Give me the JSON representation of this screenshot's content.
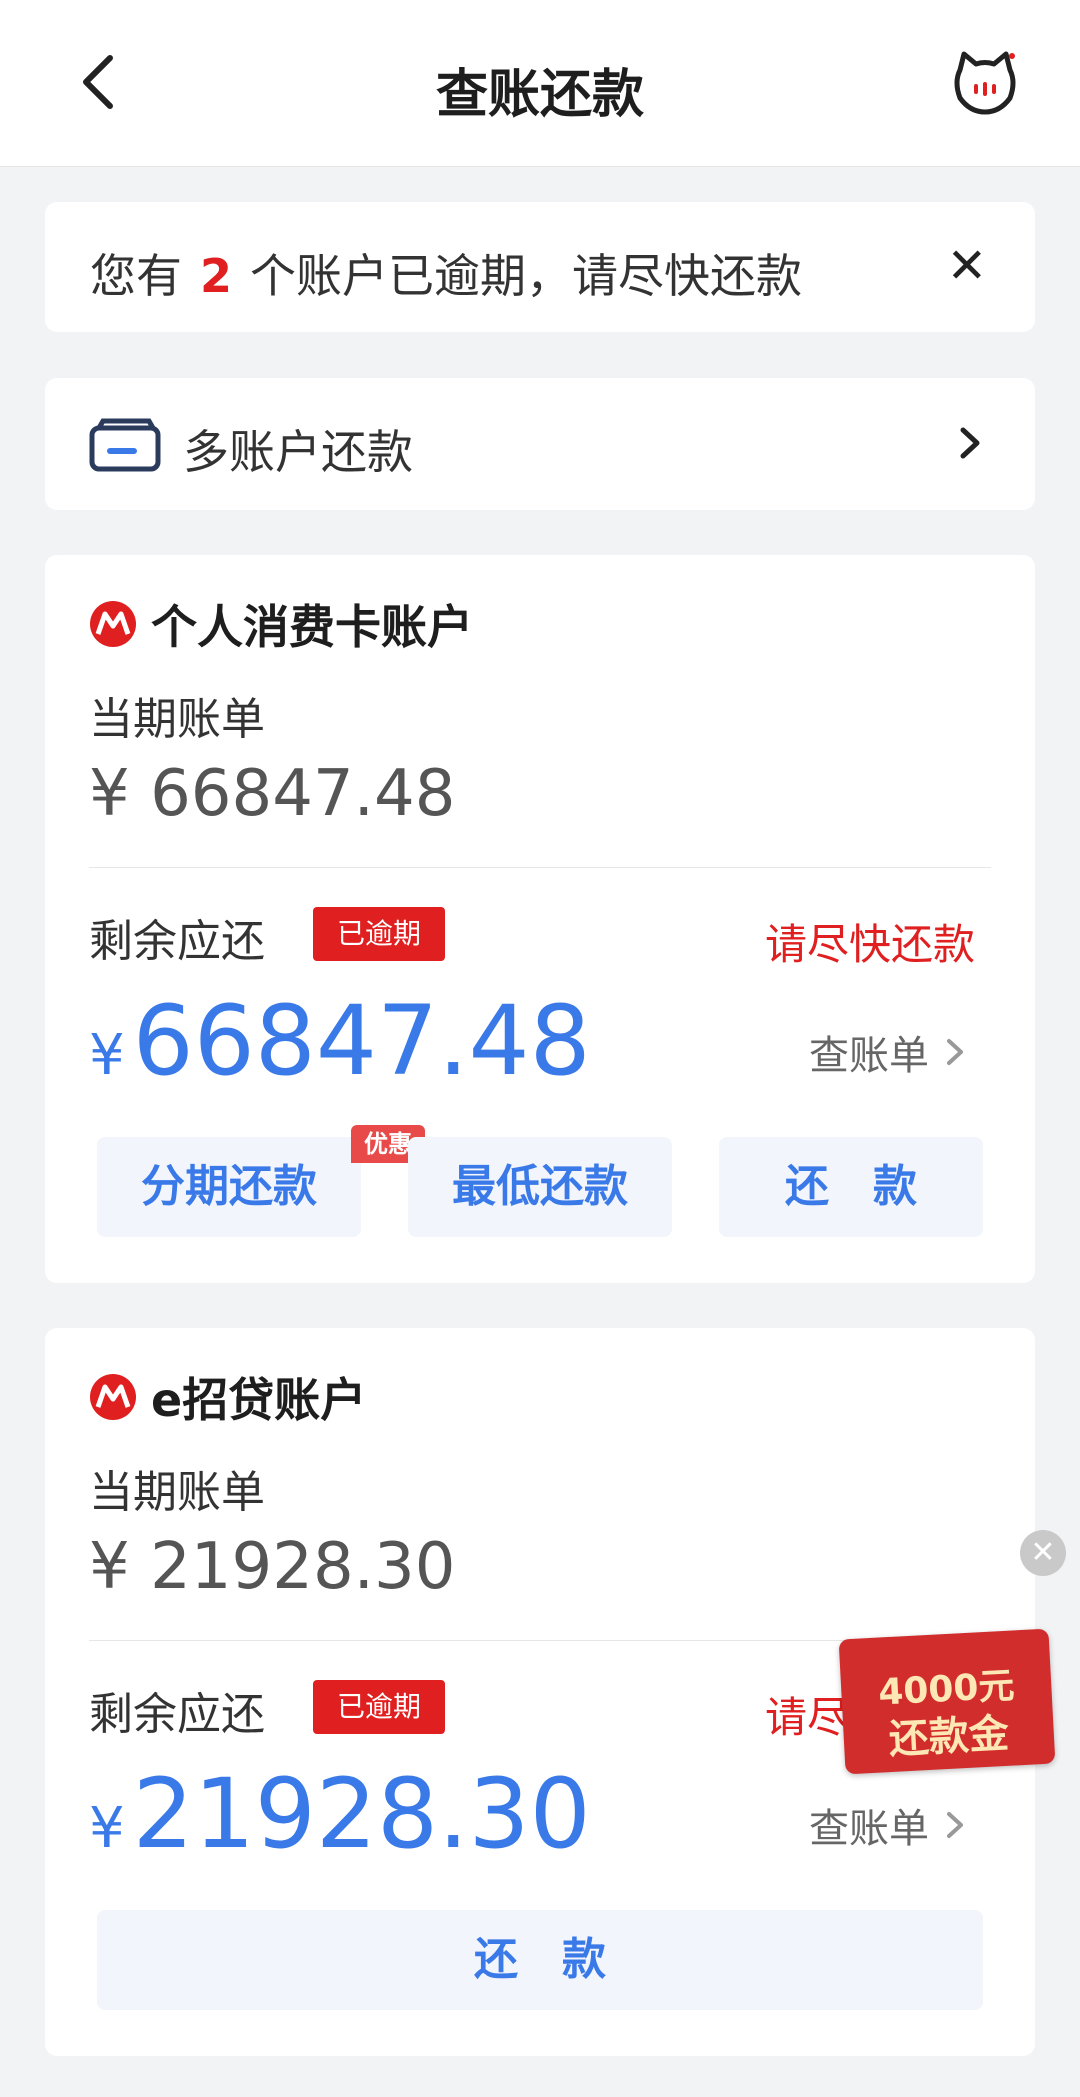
{
  "header": {
    "title": "查账还款"
  },
  "notice": {
    "prefix": "您有",
    "count": "2",
    "suffix": "个账户已逾期，请尽快还款"
  },
  "multi": {
    "label": "多账户还款"
  },
  "accounts": [
    {
      "name": "个人消费卡账户",
      "current_label": "当期账单",
      "current_amount": "¥ 66847.48",
      "remaining_label": "剩余应还",
      "overdue_badge": "已逾期",
      "urge": "请尽快还款",
      "currency": "¥",
      "remaining_amount": "66847.48",
      "view_bill": "查账单",
      "buttons": [
        "分期还款",
        "最低还款",
        "还　款"
      ],
      "promo_tag": "优惠"
    },
    {
      "name": "e招贷账户",
      "current_label": "当期账单",
      "current_amount": "¥ 21928.30",
      "remaining_label": "剩余应还",
      "overdue_badge": "已逾期",
      "urge": "请尽快还款",
      "currency": "¥",
      "remaining_amount": "21928.30",
      "view_bill": "查账单",
      "buttons": [
        "还　款"
      ]
    }
  ],
  "float": {
    "line1": "4000元",
    "line2": "还款金"
  },
  "colors": {
    "accent": "#3a79e8",
    "danger": "#e02020",
    "background": "#f2f3f5"
  }
}
